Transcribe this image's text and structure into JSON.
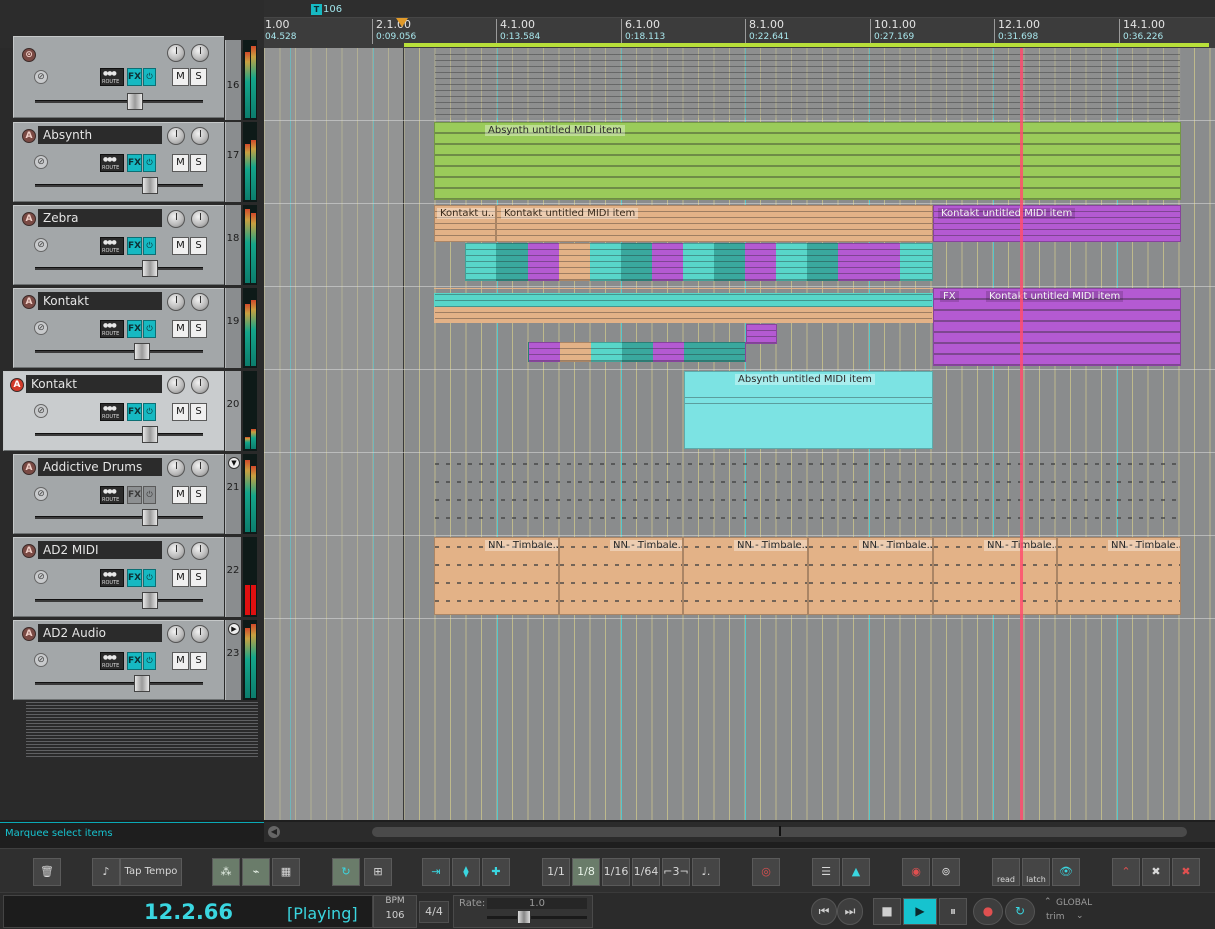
{
  "ruler": {
    "tempo_marker": "106",
    "bars": [
      {
        "label": "1.00",
        "time": "04.528"
      },
      {
        "label": "2.1.00",
        "time": "0:09.056"
      },
      {
        "label": "4.1.00",
        "time": "0:13.584"
      },
      {
        "label": "6.1.00",
        "time": "0:18.113"
      },
      {
        "label": "8.1.00",
        "time": "0:22.641"
      },
      {
        "label": "10.1.00",
        "time": "0:27.169"
      },
      {
        "label": "12.1.00",
        "time": "0:31.698"
      },
      {
        "label": "14.1.00",
        "time": "0:36.226"
      }
    ]
  },
  "tracks": [
    {
      "number": "16",
      "name": ""
    },
    {
      "number": "17",
      "name": "Absynth"
    },
    {
      "number": "18",
      "name": "Zebra"
    },
    {
      "number": "19",
      "name": "Kontakt"
    },
    {
      "number": "20",
      "name": "Kontakt"
    },
    {
      "number": "21",
      "name": "Addictive Drums"
    },
    {
      "number": "22",
      "name": "AD2 MIDI"
    },
    {
      "number": "23",
      "name": "AD2 Audio"
    }
  ],
  "track_controls": {
    "arm": "A",
    "fx": "FX",
    "route": "ROUTE",
    "mute": "M",
    "solo": "S"
  },
  "items": {
    "absynth_1": "Absynth untitled MIDI item",
    "kontakt_short": "Kontakt u...",
    "kontakt_1": "Kontakt untitled MIDI item",
    "kontakt_2": "Kontakt untitled MIDI item",
    "kontakt_3": "Kontakt untitled MIDI item",
    "absynth_2": "Absynth untitled MIDI item",
    "timbale": "NN - Timbale...",
    "fx_badge": "FX"
  },
  "status": {
    "text": "Marquee select items"
  },
  "toolbar": {
    "tap_tempo": "Tap Tempo",
    "grid_1_1": "1/1",
    "grid_1_8": "1/8",
    "grid_1_16": "1/16",
    "grid_1_64": "1/64",
    "triplet": "⌐3¬",
    "dotted": "♩.",
    "read": "read",
    "latch": "latch"
  },
  "transport": {
    "position": "12.2.66",
    "state": "[Playing]",
    "bpm_label": "BPM",
    "bpm_value": "106",
    "time_signature": "4/4",
    "rate_label": "Rate:",
    "rate_value": "1.0",
    "automation_global": "GLOBAL",
    "automation_mode": "trim"
  },
  "colors": {
    "accent": "#16b9c2",
    "absynth_item": "#9acb5a",
    "kontakt_item": "#e3b287",
    "purple_item": "#b45ad2",
    "teal_item": "#58d6c9",
    "cyan_item": "#7ce3e3",
    "timbale_item": "#e3b287",
    "play_cursor": "#ff4d6e",
    "loop": "#b8e03a"
  }
}
